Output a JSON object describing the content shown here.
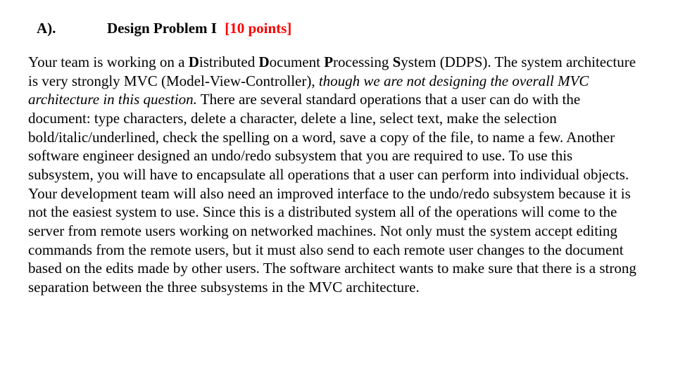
{
  "heading": {
    "label": "A).",
    "title": "Design Problem I",
    "points": "[10 points]"
  },
  "body": {
    "seg01": "Your team is working on a ",
    "seg02_bold_D": "D",
    "seg03": "istributed ",
    "seg04_bold_D2": "D",
    "seg05": "ocument ",
    "seg06_bold_P": "P",
    "seg07": "rocessing ",
    "seg08_bold_S": "S",
    "seg09": "ystem (DDPS). The system architecture is very strongly MVC (Model-View-Controller), ",
    "seg10_italic": "though we are not designing the overall MVC architecture in this question.",
    "seg11": " There are several standard operations that a user can do with the document: type characters, delete a character, delete a line, select text, make the selection bold/italic/underlined, check the spelling on a word, save a copy of the file, to name a few. Another software engineer designed an undo/redo subsystem that you are required to use. To use this subsystem, you will have to encapsulate all operations that a user can perform into individual objects. Your development team will also need an improved interface to the undo/redo subsystem because it is not the easiest system to use. Since this is a distributed system all of the operations will come to the server from remote users working on networked machines. Not only must the system accept editing commands from the remote users, but it must also send to each remote user changes to the document based on the edits made by other users. The software architect wants to make sure that there is a strong separation between the three subsystems in the MVC architecture."
  }
}
